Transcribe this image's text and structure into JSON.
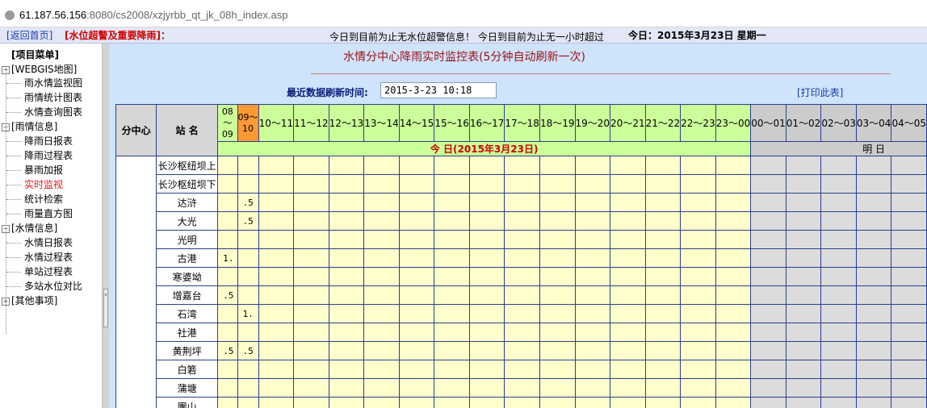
{
  "browser": {
    "url_host": "61.187.56.156",
    "url_path": ":8080/cs2008/xzjyrbb_qt_jk_08h_index.asp"
  },
  "topbar": {
    "home_link": "[返回首页]",
    "alarm_link": "[水位超警及重要降雨]：",
    "marquee": "今日到目前为止无水位超警信息！   今日到目前为止无一小时超过",
    "date": "今日：2015年3月23日  星期一"
  },
  "sidebar": {
    "title": "[项目菜单]",
    "groups": [
      {
        "label": "[WEBGIS地图]",
        "items": [
          "雨水情监视图",
          "雨情统计图表",
          "水情查询图表"
        ]
      },
      {
        "label": "[雨情信息]",
        "items": [
          "降雨日报表",
          "降雨过程表",
          "暴雨加报",
          "实时监视",
          "统计检索",
          "雨量直方图"
        ]
      },
      {
        "label": "[水情信息]",
        "items": [
          "水情日报表",
          "水情过程表",
          "单站过程表",
          "多站水位对比"
        ]
      },
      {
        "label": "[其他事项]",
        "items": []
      }
    ],
    "active_item": "实时监视"
  },
  "main": {
    "title": "水情分中心降雨实时监控表(5分钟自动刷新一次)",
    "refresh_label": "最近数据刷新时间:",
    "refresh_value": "2015-3-23 10:18",
    "print_link": "[打印此表]"
  },
  "table": {
    "header_center": "分中心",
    "header_station": "站  名",
    "today_hours": [
      "08～09",
      "09～10",
      "10～11",
      "11～12",
      "12～13",
      "13～14",
      "14～15",
      "15～16",
      "16～17",
      "17～18",
      "18～19",
      "19～20",
      "20～21",
      "21～22",
      "22～23",
      "23～00"
    ],
    "tomorrow_hours": [
      "00～01",
      "01～02",
      "02～03",
      "03～04",
      "04～05"
    ],
    "today_label": "今  日(2015年3月23日)",
    "tomorrow_label": "明  日",
    "rows": [
      {
        "station": "长沙枢纽坝上",
        "v1": "",
        "v2": ""
      },
      {
        "station": "长沙枢纽坝下",
        "v1": "",
        "v2": ""
      },
      {
        "station": "达浒",
        "v1": "",
        "v2": ".5"
      },
      {
        "station": "大光",
        "v1": "",
        "v2": ".5"
      },
      {
        "station": "光明",
        "v1": "",
        "v2": ""
      },
      {
        "station": "古港",
        "v1": "1.",
        "v2": ""
      },
      {
        "station": "寒婆坳",
        "v1": "",
        "v2": ""
      },
      {
        "station": "增嘉台",
        "v1": ".5",
        "v2": ""
      },
      {
        "station": "石湾",
        "v1": "",
        "v2": "1."
      },
      {
        "station": "社港",
        "v1": "",
        "v2": ""
      },
      {
        "station": "黄荆坪",
        "v1": ".5",
        "v2": ".5"
      },
      {
        "station": "白箬",
        "v1": "",
        "v2": ""
      },
      {
        "station": "蒲塘",
        "v1": "",
        "v2": ""
      },
      {
        "station": "團山",
        "v1": "",
        "v2": ""
      }
    ]
  }
}
